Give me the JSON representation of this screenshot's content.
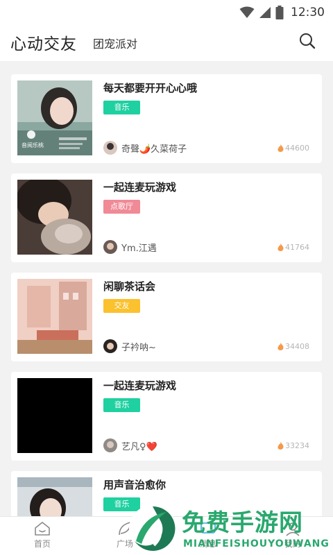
{
  "status_bar": {
    "time": "12:30"
  },
  "header": {
    "title": "心动交友",
    "tab": "团宠派对"
  },
  "rooms": [
    {
      "title": "每天都要开开心心哦",
      "tag": "音乐",
      "tag_color": "#1fd0a0",
      "host": "奇聲🌶️久菜荷子",
      "heat": "44600"
    },
    {
      "title": "一起连麦玩游戏",
      "tag": "点歌厅",
      "tag_color": "#f08a96",
      "host": "Ym.江遇",
      "heat": "41764"
    },
    {
      "title": "闲聊茶话会",
      "tag": "交友",
      "tag_color": "#fbc12e",
      "host": "子衿呐~",
      "heat": "34408"
    },
    {
      "title": "一起连麦玩游戏",
      "tag": "音乐",
      "tag_color": "#1fd0a0",
      "host": "艺凡♀❤️",
      "heat": "33234"
    },
    {
      "title": "用声音治愈你",
      "tag": "音乐",
      "tag_color": "#1fd0a0"
    }
  ],
  "thumb_overlay": {
    "label": "音阅乐桃"
  },
  "tabbar": {
    "home": "首页",
    "square": "广场",
    "messages": "消息",
    "mine": "我的"
  },
  "watermark": {
    "main": "免费手游网",
    "sub": "MIANFEISHOUYOUWANG"
  },
  "colors": {
    "accent": "#1fd0a0",
    "heat_icon": "#f39a4b"
  }
}
